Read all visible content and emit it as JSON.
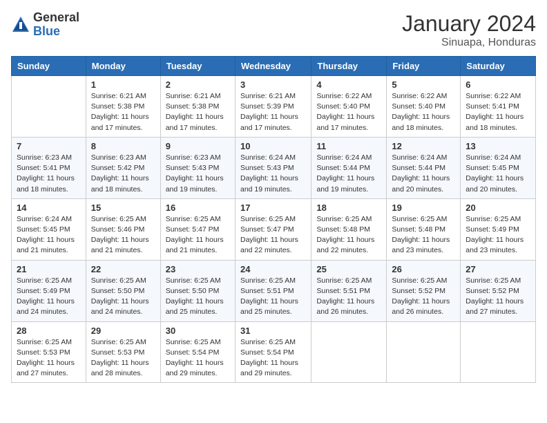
{
  "header": {
    "logo_general": "General",
    "logo_blue": "Blue",
    "month_title": "January 2024",
    "subtitle": "Sinuapa, Honduras"
  },
  "days_of_week": [
    "Sunday",
    "Monday",
    "Tuesday",
    "Wednesday",
    "Thursday",
    "Friday",
    "Saturday"
  ],
  "weeks": [
    [
      {
        "day": "",
        "sunrise": "",
        "sunset": "",
        "daylight": ""
      },
      {
        "day": "1",
        "sunrise": "Sunrise: 6:21 AM",
        "sunset": "Sunset: 5:38 PM",
        "daylight": "Daylight: 11 hours and 17 minutes."
      },
      {
        "day": "2",
        "sunrise": "Sunrise: 6:21 AM",
        "sunset": "Sunset: 5:38 PM",
        "daylight": "Daylight: 11 hours and 17 minutes."
      },
      {
        "day": "3",
        "sunrise": "Sunrise: 6:21 AM",
        "sunset": "Sunset: 5:39 PM",
        "daylight": "Daylight: 11 hours and 17 minutes."
      },
      {
        "day": "4",
        "sunrise": "Sunrise: 6:22 AM",
        "sunset": "Sunset: 5:40 PM",
        "daylight": "Daylight: 11 hours and 17 minutes."
      },
      {
        "day": "5",
        "sunrise": "Sunrise: 6:22 AM",
        "sunset": "Sunset: 5:40 PM",
        "daylight": "Daylight: 11 hours and 18 minutes."
      },
      {
        "day": "6",
        "sunrise": "Sunrise: 6:22 AM",
        "sunset": "Sunset: 5:41 PM",
        "daylight": "Daylight: 11 hours and 18 minutes."
      }
    ],
    [
      {
        "day": "7",
        "sunrise": "Sunrise: 6:23 AM",
        "sunset": "Sunset: 5:41 PM",
        "daylight": "Daylight: 11 hours and 18 minutes."
      },
      {
        "day": "8",
        "sunrise": "Sunrise: 6:23 AM",
        "sunset": "Sunset: 5:42 PM",
        "daylight": "Daylight: 11 hours and 18 minutes."
      },
      {
        "day": "9",
        "sunrise": "Sunrise: 6:23 AM",
        "sunset": "Sunset: 5:43 PM",
        "daylight": "Daylight: 11 hours and 19 minutes."
      },
      {
        "day": "10",
        "sunrise": "Sunrise: 6:24 AM",
        "sunset": "Sunset: 5:43 PM",
        "daylight": "Daylight: 11 hours and 19 minutes."
      },
      {
        "day": "11",
        "sunrise": "Sunrise: 6:24 AM",
        "sunset": "Sunset: 5:44 PM",
        "daylight": "Daylight: 11 hours and 19 minutes."
      },
      {
        "day": "12",
        "sunrise": "Sunrise: 6:24 AM",
        "sunset": "Sunset: 5:44 PM",
        "daylight": "Daylight: 11 hours and 20 minutes."
      },
      {
        "day": "13",
        "sunrise": "Sunrise: 6:24 AM",
        "sunset": "Sunset: 5:45 PM",
        "daylight": "Daylight: 11 hours and 20 minutes."
      }
    ],
    [
      {
        "day": "14",
        "sunrise": "Sunrise: 6:24 AM",
        "sunset": "Sunset: 5:45 PM",
        "daylight": "Daylight: 11 hours and 21 minutes."
      },
      {
        "day": "15",
        "sunrise": "Sunrise: 6:25 AM",
        "sunset": "Sunset: 5:46 PM",
        "daylight": "Daylight: 11 hours and 21 minutes."
      },
      {
        "day": "16",
        "sunrise": "Sunrise: 6:25 AM",
        "sunset": "Sunset: 5:47 PM",
        "daylight": "Daylight: 11 hours and 21 minutes."
      },
      {
        "day": "17",
        "sunrise": "Sunrise: 6:25 AM",
        "sunset": "Sunset: 5:47 PM",
        "daylight": "Daylight: 11 hours and 22 minutes."
      },
      {
        "day": "18",
        "sunrise": "Sunrise: 6:25 AM",
        "sunset": "Sunset: 5:48 PM",
        "daylight": "Daylight: 11 hours and 22 minutes."
      },
      {
        "day": "19",
        "sunrise": "Sunrise: 6:25 AM",
        "sunset": "Sunset: 5:48 PM",
        "daylight": "Daylight: 11 hours and 23 minutes."
      },
      {
        "day": "20",
        "sunrise": "Sunrise: 6:25 AM",
        "sunset": "Sunset: 5:49 PM",
        "daylight": "Daylight: 11 hours and 23 minutes."
      }
    ],
    [
      {
        "day": "21",
        "sunrise": "Sunrise: 6:25 AM",
        "sunset": "Sunset: 5:49 PM",
        "daylight": "Daylight: 11 hours and 24 minutes."
      },
      {
        "day": "22",
        "sunrise": "Sunrise: 6:25 AM",
        "sunset": "Sunset: 5:50 PM",
        "daylight": "Daylight: 11 hours and 24 minutes."
      },
      {
        "day": "23",
        "sunrise": "Sunrise: 6:25 AM",
        "sunset": "Sunset: 5:50 PM",
        "daylight": "Daylight: 11 hours and 25 minutes."
      },
      {
        "day": "24",
        "sunrise": "Sunrise: 6:25 AM",
        "sunset": "Sunset: 5:51 PM",
        "daylight": "Daylight: 11 hours and 25 minutes."
      },
      {
        "day": "25",
        "sunrise": "Sunrise: 6:25 AM",
        "sunset": "Sunset: 5:51 PM",
        "daylight": "Daylight: 11 hours and 26 minutes."
      },
      {
        "day": "26",
        "sunrise": "Sunrise: 6:25 AM",
        "sunset": "Sunset: 5:52 PM",
        "daylight": "Daylight: 11 hours and 26 minutes."
      },
      {
        "day": "27",
        "sunrise": "Sunrise: 6:25 AM",
        "sunset": "Sunset: 5:52 PM",
        "daylight": "Daylight: 11 hours and 27 minutes."
      }
    ],
    [
      {
        "day": "28",
        "sunrise": "Sunrise: 6:25 AM",
        "sunset": "Sunset: 5:53 PM",
        "daylight": "Daylight: 11 hours and 27 minutes."
      },
      {
        "day": "29",
        "sunrise": "Sunrise: 6:25 AM",
        "sunset": "Sunset: 5:53 PM",
        "daylight": "Daylight: 11 hours and 28 minutes."
      },
      {
        "day": "30",
        "sunrise": "Sunrise: 6:25 AM",
        "sunset": "Sunset: 5:54 PM",
        "daylight": "Daylight: 11 hours and 29 minutes."
      },
      {
        "day": "31",
        "sunrise": "Sunrise: 6:25 AM",
        "sunset": "Sunset: 5:54 PM",
        "daylight": "Daylight: 11 hours and 29 minutes."
      },
      {
        "day": "",
        "sunrise": "",
        "sunset": "",
        "daylight": ""
      },
      {
        "day": "",
        "sunrise": "",
        "sunset": "",
        "daylight": ""
      },
      {
        "day": "",
        "sunrise": "",
        "sunset": "",
        "daylight": ""
      }
    ]
  ]
}
